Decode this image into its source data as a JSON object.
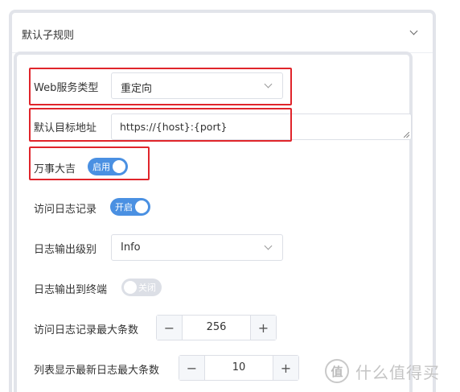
{
  "section": {
    "title": "默认子规则"
  },
  "fields": {
    "web_service_type": {
      "label": "Web服务类型",
      "value": "重定向"
    },
    "default_target": {
      "label": "默认目标地址",
      "value": "https://{host}:{port}"
    },
    "wanshi_daji": {
      "label": "万事大吉",
      "toggle_text": "启用",
      "on": true
    },
    "access_log": {
      "label": "访问日志记录",
      "toggle_text": "开启",
      "on": true
    },
    "log_level": {
      "label": "日志输出级别",
      "value": "Info"
    },
    "log_to_terminal": {
      "label": "日志输出到终端",
      "toggle_text": "关闭",
      "on": false
    },
    "access_log_max": {
      "label": "访问日志记录最大条数",
      "value": "256",
      "minus": "−",
      "plus": "+"
    },
    "list_log_max": {
      "label": "列表显示最新日志最大条数",
      "value": "10",
      "minus": "−",
      "plus": "+"
    }
  },
  "colors": {
    "accent": "#4a90e2",
    "highlight": "#e0252b"
  },
  "watermark": {
    "logo_text": "值",
    "text": "什么值得买"
  }
}
